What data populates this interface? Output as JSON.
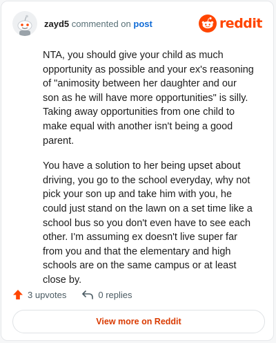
{
  "header": {
    "username": "zayd5",
    "commented_text": "commented on",
    "post_link": "post",
    "logo_text": "reddit"
  },
  "comment": {
    "paragraphs": [
      "NTA, you should give your child as much opportunity as possible and your ex's reasoning of \"animosity between her daughter and our son as he will have more opportunities\" is silly. Taking away opportunities from one child to make equal with another isn't being a good parent.",
      "You have a solution to her being upset about driving, you go to the school everyday, why not pick your son up and take him with you, he could just stand on the lawn on a set time like a school bus so you don't even have to see each other. I'm assuming ex doesn't live super far from you and that the elementary and high schools are on the same campus or at least close by."
    ]
  },
  "footer": {
    "upvotes": "3 upvotes",
    "replies": "0 replies"
  },
  "actions": {
    "view_more": "View more on Reddit"
  },
  "colors": {
    "brand": "#ff4500",
    "link": "#0f6bd6",
    "view_more": "#d93a00"
  }
}
